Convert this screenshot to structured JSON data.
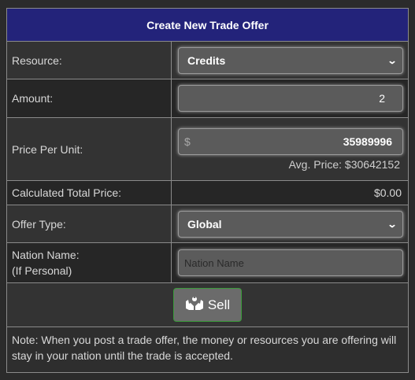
{
  "header": {
    "title": "Create New Trade Offer"
  },
  "resource": {
    "label": "Resource:",
    "selected": "Credits"
  },
  "amount": {
    "label": "Amount:",
    "value": "2"
  },
  "price": {
    "label": "Price Per Unit:",
    "currency": "$",
    "value": "35989996",
    "avg": "Avg. Price: $30642152"
  },
  "total": {
    "label": "Calculated Total Price:",
    "value": "$0.00"
  },
  "offer_type": {
    "label": "Offer Type:",
    "selected": "Global"
  },
  "nation": {
    "label_line1": "Nation Name:",
    "label_line2": "(If Personal)",
    "placeholder": "Nation Name"
  },
  "sell": {
    "label": "Sell",
    "icon": "hands-icon"
  },
  "note": "Note: When you post a trade offer, the money or resources you are offering will stay in your nation until the trade is accepted."
}
